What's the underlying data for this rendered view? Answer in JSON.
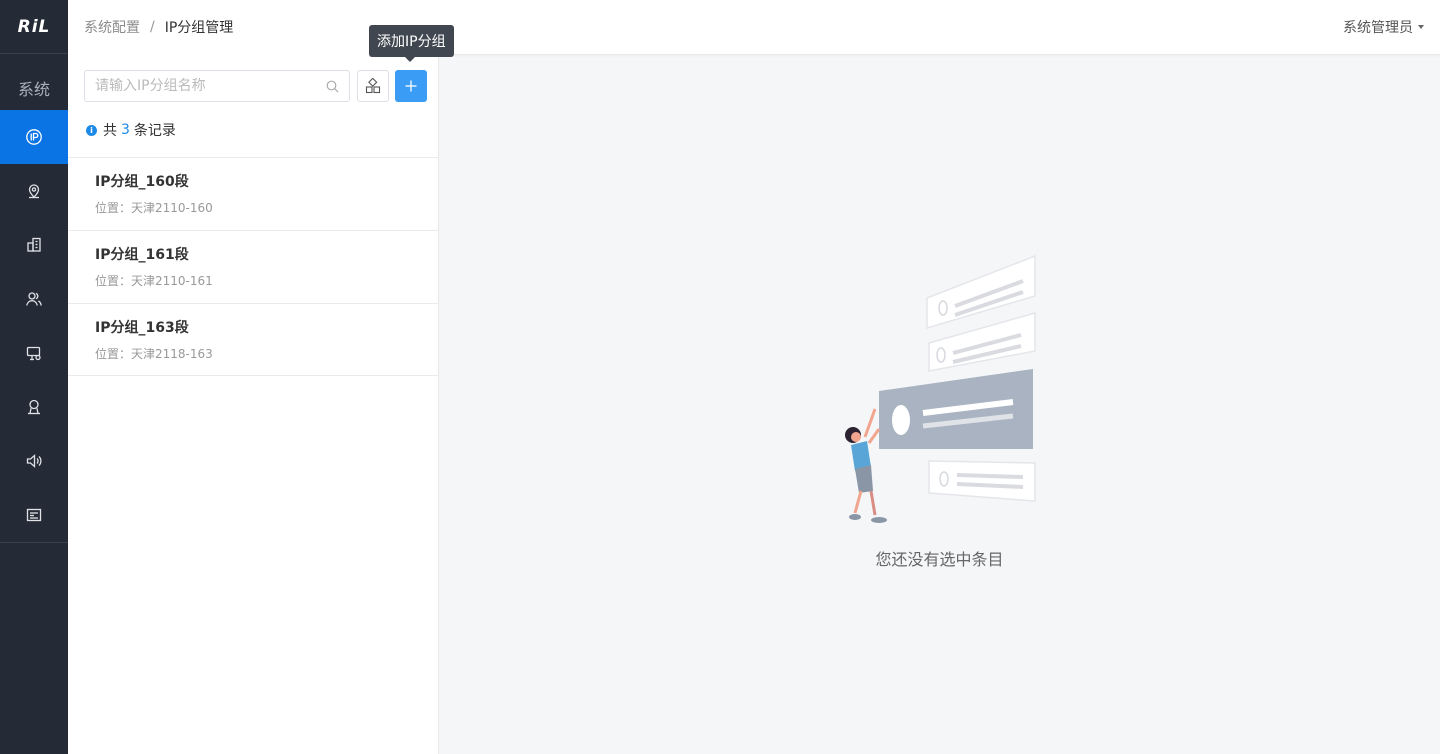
{
  "app": {
    "logo_text": "RiL"
  },
  "sidebar": {
    "section_label": "系统",
    "items": [
      {
        "icon": "ip-icon",
        "active": true
      },
      {
        "icon": "location-icon",
        "active": false
      },
      {
        "icon": "building-icon",
        "active": false
      },
      {
        "icon": "users-icon",
        "active": false
      },
      {
        "icon": "device-icon",
        "active": false
      },
      {
        "icon": "user-icon",
        "active": false
      },
      {
        "icon": "speaker-icon",
        "active": false
      },
      {
        "icon": "document-icon",
        "active": false
      }
    ]
  },
  "header": {
    "breadcrumb": [
      "系统配置",
      "IP分组管理"
    ],
    "separator": "/",
    "user": "系统管理员"
  },
  "panel": {
    "search_placeholder": "请输入IP分组名称",
    "add_tooltip": "添加IP分组",
    "count_prefix": "共",
    "count_value": "3",
    "count_suffix": "条记录",
    "items": [
      {
        "name": "IP分组_160段",
        "location": "位置：天津2110-160"
      },
      {
        "name": "IP分组_161段",
        "location": "位置：天津2110-161"
      },
      {
        "name": "IP分组_163段",
        "location": "位置：天津2118-163"
      }
    ]
  },
  "empty_state": {
    "message": "您还没有选中条目"
  },
  "colors": {
    "sidebar_bg": "#252b36",
    "accent": "#0b74e5",
    "primary_button": "#3a9cf5"
  }
}
